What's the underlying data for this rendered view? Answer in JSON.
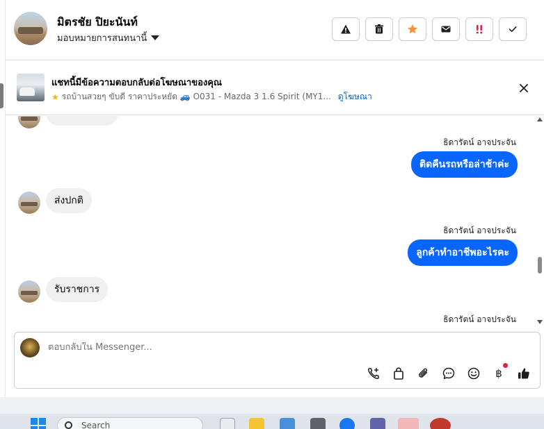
{
  "header": {
    "name": "มิตรชัย ปิยะนันท์",
    "assign_label": "มอบหมายการสนทนานี้",
    "actions": [
      {
        "name": "report-spam-button",
        "icon": "warning-icon"
      },
      {
        "name": "delete-button",
        "icon": "trash-icon"
      },
      {
        "name": "star-button",
        "icon": "star-icon",
        "color": "#f7923a"
      },
      {
        "name": "mark-unread-button",
        "icon": "mail-icon"
      },
      {
        "name": "follow-up-button",
        "icon": "exclamation-icon",
        "color": "#e41e3f"
      },
      {
        "name": "mark-done-button",
        "icon": "check-icon"
      }
    ]
  },
  "banner": {
    "title": "แชทนี้มีข้อความตอบกลับต่อโฆษณาของคุณ",
    "subtitle": "รถบ้านสวยๆ ขับดี ราคาประหยัด 🚙 O031 - Mazda 3 1.6 Spirit (MY1...",
    "link": "ดูโฆษณา"
  },
  "messages": {
    "out1_sender": "ธิดารัตน์ อาจประจัน",
    "out1_text": "ติดคืนรถหรือล่าช้าค่ะ",
    "in1_text": "ส่งปกติ",
    "out2_sender": "ธิดารัตน์ อาจประจัน",
    "out2_text": "ลูกค้าทำอาชีพอะไรคะ",
    "in2_text": "รับราชการ",
    "out3_sender": "ธิดารัตน์ อาจประจัน"
  },
  "composer": {
    "placeholder": "ตอบกลับใน Messenger...",
    "tools": [
      "phone-plus-icon",
      "bag-icon",
      "paperclip-icon",
      "chat-bubble-icon",
      "smiley-icon",
      "baht-icon",
      "thumbs-up-icon"
    ],
    "baht_symbol": "฿"
  },
  "taskbar": {
    "search_placeholder": "Search"
  },
  "colors": {
    "outgoing_bubble": "#0866ff",
    "incoming_bubble": "#f0f0f0",
    "link": "#0064d1"
  }
}
